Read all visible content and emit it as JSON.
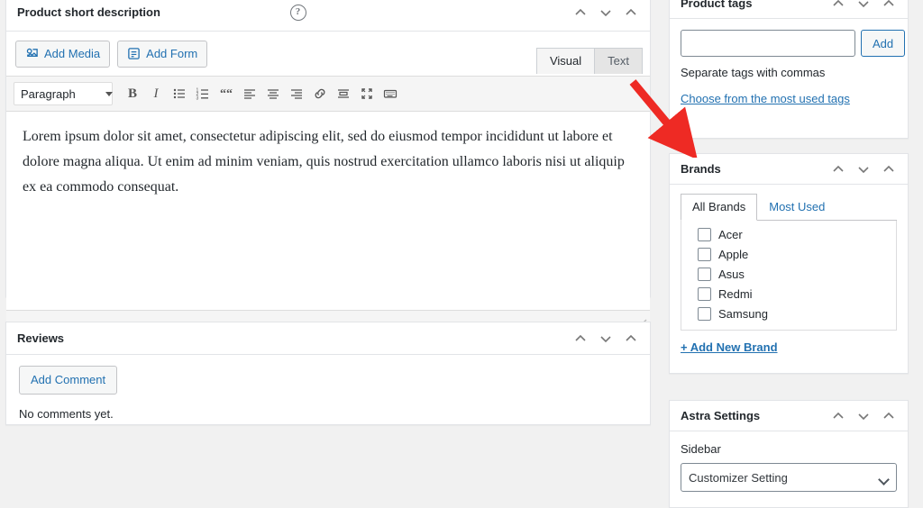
{
  "short_description": {
    "title": "Product short description",
    "help_icon": "?",
    "buttons": {
      "add_media": "Add Media",
      "add_form": "Add Form"
    },
    "editor_tabs": [
      {
        "label": "Visual",
        "active": true
      },
      {
        "label": "Text",
        "active": false
      }
    ],
    "toolbar": {
      "format_select": "Paragraph",
      "items": [
        "bold",
        "italic",
        "bulleted-list",
        "numbered-list",
        "blockquote",
        "align-left",
        "align-center",
        "align-right",
        "insert-link",
        "insert-read-more",
        "fullscreen",
        "toolbar-toggle"
      ]
    },
    "content": "Lorem ipsum dolor sit amet, consectetur adipiscing elit, sed do eiusmod tempor incididunt ut labore et dolore magna aliqua. Ut enim ad minim veniam, quis nostrud exercitation ullamco laboris nisi ut aliquip ex ea commodo consequat."
  },
  "reviews": {
    "title": "Reviews",
    "add_comment": "Add Comment",
    "empty_text": "No comments yet."
  },
  "product_tags": {
    "title": "Product tags",
    "input_value": "",
    "add_button": "Add",
    "hint": "Separate tags with commas",
    "most_used_link": "Choose from the most used tags"
  },
  "brands": {
    "title": "Brands",
    "tabs": [
      {
        "label": "All Brands",
        "active": true
      },
      {
        "label": "Most Used",
        "active": false
      }
    ],
    "items": [
      {
        "label": "Acer",
        "checked": false
      },
      {
        "label": "Apple",
        "checked": false
      },
      {
        "label": "Asus",
        "checked": false
      },
      {
        "label": "Redmi",
        "checked": false
      },
      {
        "label": "Samsung",
        "checked": false
      }
    ],
    "add_new": "+ Add New Brand"
  },
  "astra_settings": {
    "title": "Astra Settings",
    "sidebar_label": "Sidebar",
    "sidebar_value": "Customizer Setting"
  },
  "annotation": {
    "arrow_color": "#ee2a24"
  }
}
